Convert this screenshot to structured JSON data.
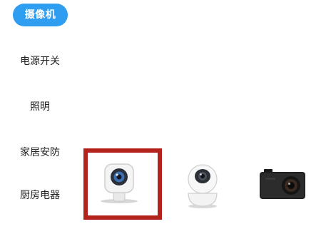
{
  "header": {
    "category_label": "摄像机"
  },
  "sidebar": {
    "items": [
      {
        "label": "电源开关"
      },
      {
        "label": "照明"
      },
      {
        "label": "家居安防"
      },
      {
        "label": "厨房电器"
      }
    ]
  },
  "devices": [
    {
      "icon": "mini-camera-icon",
      "selected": true
    },
    {
      "icon": "ptz-camera-icon",
      "selected": false
    },
    {
      "icon": "action-camera-icon",
      "selected": false
    }
  ],
  "colors": {
    "accent": "#2f9df0",
    "selection_border": "#b3221b"
  }
}
